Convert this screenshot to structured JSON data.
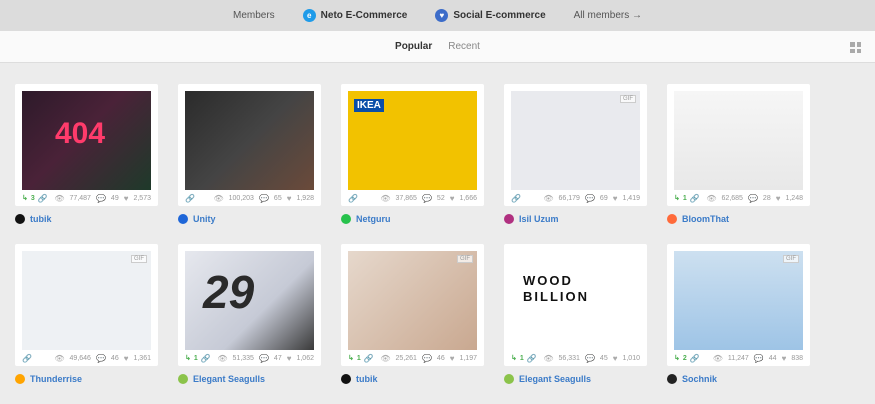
{
  "topnav": {
    "members": "Members",
    "neto": "Neto E-Commerce",
    "social": "Social E-commerce",
    "all": "All members →"
  },
  "tabs": {
    "popular": "Popular",
    "recent": "Recent"
  },
  "shots": [
    {
      "rebounds": "3",
      "views": "77,487",
      "comments": "49",
      "likes": "2,573",
      "author": "tubik",
      "thumb_text": "404",
      "gif": ""
    },
    {
      "rebounds": "",
      "views": "100,203",
      "comments": "65",
      "likes": "1,928",
      "author": "Unity",
      "thumb_text": "",
      "gif": ""
    },
    {
      "rebounds": "",
      "views": "37,865",
      "comments": "52",
      "likes": "1,666",
      "author": "Netguru",
      "thumb_text": "IKEA",
      "gif": ""
    },
    {
      "rebounds": "",
      "views": "66,179",
      "comments": "69",
      "likes": "1,419",
      "author": "Isil Uzum",
      "thumb_text": "",
      "gif": "GIF"
    },
    {
      "rebounds": "1",
      "views": "62,685",
      "comments": "28",
      "likes": "1,248",
      "author": "BloomThat",
      "thumb_text": "",
      "gif": ""
    },
    {
      "rebounds": "",
      "views": "49,646",
      "comments": "46",
      "likes": "1,361",
      "author": "Thunderrise",
      "thumb_text": "",
      "gif": "GIF"
    },
    {
      "rebounds": "1",
      "views": "51,335",
      "comments": "47",
      "likes": "1,062",
      "author": "Elegant Seagulls",
      "thumb_text": "29",
      "gif": ""
    },
    {
      "rebounds": "1",
      "views": "25,261",
      "comments": "46",
      "likes": "1,197",
      "author": "tubik",
      "thumb_text": "",
      "gif": "GIF"
    },
    {
      "rebounds": "1",
      "views": "56,331",
      "comments": "45",
      "likes": "1,010",
      "author": "Elegant Seagulls",
      "thumb_text": "WOOD BILLION",
      "gif": ""
    },
    {
      "rebounds": "2",
      "views": "11,247",
      "comments": "44",
      "likes": "838",
      "author": "Sochnik",
      "thumb_text": "",
      "gif": "GIF"
    }
  ],
  "colors": {
    "link": "#3b7bc8",
    "rebound": "#4caf50"
  }
}
